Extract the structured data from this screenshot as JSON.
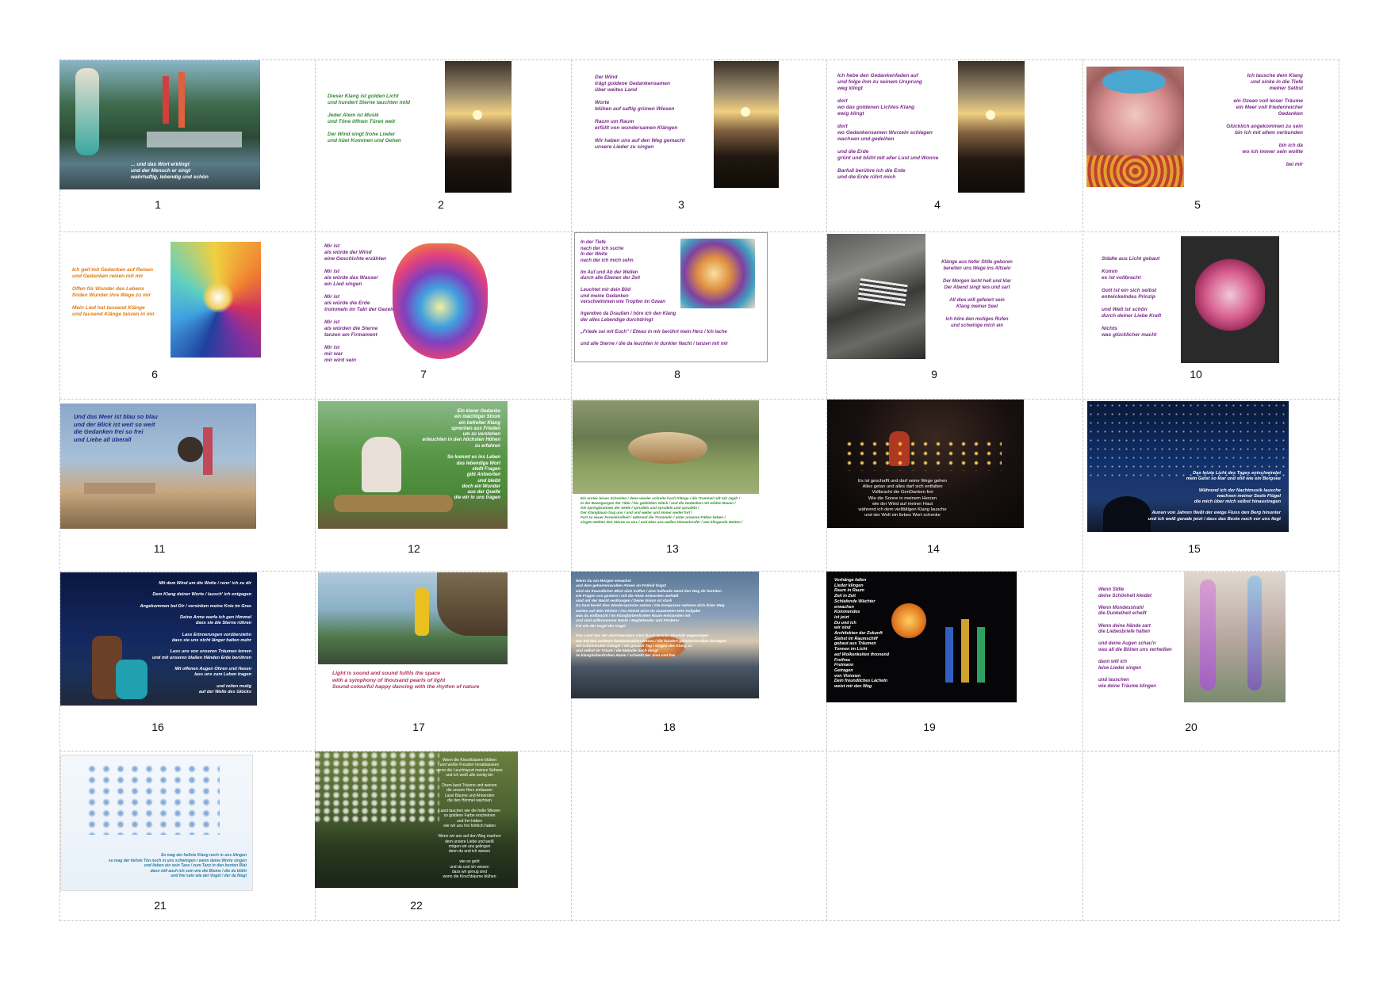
{
  "cards": [
    {
      "number": "1",
      "caption": "... und das Wort erklingt\nund der Mensch er singt\nwahrhaftig, lebendig und schön",
      "text_color": "#ffffff"
    },
    {
      "number": "2",
      "caption": "Dieser Klang ist golden Licht\nund hundert Sterne tauchten mild\n\nJeder Atem ist Musik\nund Töne öffnen Türen weit\n\nDer Wind singt frohe Lieder\nund hüet Kommen und Gehen",
      "text_color": "#2e8b2e"
    },
    {
      "number": "3",
      "caption": "Der Wind\nträgt goldene Gedankensamen\nüber weites Land\n\nWorte\nblühen auf saftig grünen Wiesen\n\nRaum um Raum\nerfüllt von wundersamen Klängen\n\nWir haben uns auf den Weg gemacht\nunsere Lieder zu singen",
      "text_color": "#7a2a8a"
    },
    {
      "number": "4",
      "caption": "Ich hebe den Gedankenfaden auf\nund folge ihm zu seinem Ursprung\nweg klingt\n\ndort\nwo das goldenen Lichtes Klang\newig klingt\n\ndort\nwo Gedankensamen Wurzeln schlagen\nwachsen und gedeihen\n\nund die Erde\ngrünt und blüht mit aller Lust und Wonne\n\nBarfuß berühre ich die Erde\nund die Erde rührt mich",
      "text_color": "#7a2a8a"
    },
    {
      "number": "5",
      "caption": "Ich lausche dem Klang\nund sinke in die Tiefe\nmeiner Selbst\n\nein Ozean voll leiser Träume\nein Meer voll friedenreicher\nGedanken\n\nGlücklich angekommen zu sein\nbin ich mit allem verbunden\n\nbin ich da\nwo ich immer sein wollte\n\nbei mir",
      "text_color": "#7a2a8a"
    },
    {
      "number": "6",
      "caption": "Ich geh'mit Gedanken auf Reisen\nund Gedanken reisen mit mir\n\nOffen für Wunder des Lebens\nfinden Wunder ihre Wege zu mir\n\nMein Lied hat tausend Klänge\nund tausend Klänge tanzen in mir",
      "text_color": "#e07a10"
    },
    {
      "number": "7",
      "caption": "Mir ist\nals würde der Wind\neine Geschichte erzählen\n\nMir ist\nals würde das Wasser\nein Lied singen\n\nMir ist\nals würde die Erde\ntrommeln im Takt der Gezeiten\n\nMir ist\nals würden die Sterne\ntanzen am Firmament\n\nMir ist\nmir war\nmir wird sein",
      "text_color": "#7a2a8a"
    },
    {
      "number": "8",
      "caption": "In der Tiefe\nnach der ich suche\nIn der Weite\nnach der ich mich sehn\n\nIm Auf und Ab der Wellen\ndurch alle Ebenen der Zeit\n\nLeuchtet mir dein Bild\nund meine Gedanken\nverschwimmen wie Tropfen im Ozean\n\nIrgendwo da Draußen / höre ich den Klang\nder alles Lebendige durchdringt\n\n„Friede sei mit Euch\" / Etwas in mir berührt mein Herz / Ich lache\n\nund alle Sterne / die da leuchten in dunkler Nacht / tanzen mit mir",
      "text_color": "#7a2a8a"
    },
    {
      "number": "9",
      "caption": "Klänge aus tiefer Stille geboren\nbereiten uns Wege ins Altsein\n\nDer Morgen lacht hell und klar\nDer Abend singt leis und sart\n\nAll dies will gefeiert sein\nKlang meiner Seel\n\nIch höre den mutiges Rufen\nund schwinge mich ein",
      "text_color": "#7a2a8a"
    },
    {
      "number": "10",
      "caption": "Städte aus Licht gebaut\n\nKomm\nes ist vollbracht\n\nGott ist ein sich selbst\nentwickelndes Prinzip\n\nund Welt ist schön\ndurch deiner Liebe Kraft\n\nNichts\nwas glücklicher macht",
      "text_color": "#7a2a8a"
    },
    {
      "number": "11",
      "caption": "Und das Meer ist blau so blau\nund der Blick ist weit so weit\ndie Gedanken frei so frei\nund Liebe all überall",
      "text_color": "#1a2a8a"
    },
    {
      "number": "12",
      "caption": "Ein klarer Gedanke\nein mächtiger Strom\nein befreiter Klang\nsprechen aus Frieden\num zu verstehen\nerleuchten in den höchsten Höhen\nzu erfahren\n\nSo kommt es ins Leben\ndas lebendige Wort\nstellt Fragen\ngibt Antworten\nund bleibt\ndoch ein Wunder\naus der Quelle\ndie wir in uns tragen",
      "text_color": "#ffffff"
    },
    {
      "number": "13",
      "caption": "Ein erstes leises Schreiten / denn wieder schreite hoch Klänge / die Trommel ruft mit Jagdr /\nIn der Bewegungen der Täler / bis geblieben Glück / und die Gedanken mit wilden Bauen /\nDie Springbrunnen der Seele / sprudeln und sprudeln und sprudeln /\nDer Klangbaum trug uns / und und weiter und immer weiter fort /\nFort zu neuer Ferienkindheit / während die Trommeln / unter unseren Füßen beben /\nsingen Welten den Sterne zu uns / und über uns wellen Himmelsrufer / wer klingende Weiten /",
      "text_color": "#2e8b2e"
    },
    {
      "number": "14",
      "caption": "Es ist geschafft und darf seine Wege gehen\nAlles getan und alles darf sich entfalten\nVollbracht die GenDanken frei\nWie die Sonne in meinem Herzen\nwie der Wind auf meiner Haut\nwährend ich dem vielfältigen Klang lausche\nund der Welt ein liebes Wort schenke",
      "text_color": "#ffffff"
    },
    {
      "number": "15",
      "caption": "Das letzte Licht des Tages entschwindet\nmein Geist so klar und still wie ein Bergsee\n\nWährend ich der Nachtmusik lausche\nwachsen meiner Seele Flügel\ndie mich über mich selbst hinaustragen\n\nAunen von Jahren fließt der ewige Fluss den Berg hinunter\nund ich weiß gerade jetzt / dass das Beste noch vor uns liegt",
      "text_color": "#ffffff"
    },
    {
      "number": "16",
      "caption": "Mit dem Wind um die Wette / renn' ich zu dir\n\nDem Klang deiner Worte / lausch' ich entgegen\n\nAngekommen bei Dir / versinken meine Knie im Gras\n\nDeine Arme warfa ich gen Himmel\ndass sie die Sterne rühren\n\nLass Erinnerungen vorüberziehn\ndass sie uns nicht länger halten mehr\n\nLass uns von unseren Träumen lernen\nund mit unseren blaßen Händen Erde berühren\n\nMit offenen Augen Ohren und Hasen\nlass uns zum Leben tragen\n\nund reiten mutig\nauf der Welle des Glücks",
      "text_color": "#ffffff"
    },
    {
      "number": "17",
      "caption": "Light is sound and sound fulfils the space\nwith a symphony of thousand pearls of light\nSound colourful happy dancing with the rhythm of nature",
      "text_color": "#b03060"
    },
    {
      "number": "18",
      "caption": "Wenn Du am Morgen erwachst\nund dem geheimnisvollen Atmen im Frühnil folgst\nwird ein freundlicher Blick dich treffen / eine helfende Hand den Weg dir bereiten\nDie Fragen von gestern / mit die Ahne Antworten umhüllt\nsind mit der Nacht verklungen / Deine Vision ist stark\nDu hast bereit dies Wiedersprüche setzen / Die Ereignisse nehmen dich ihren Weg\nwarten auf dein Wirken / Am Abend wirst du zusammen eine Aufgabe\nwas du vollbracht / Im Klangfarbenfrohen Raum entstanden mit\nund sind willkommene Gäste / Begleitender und Förderer\nfrei wie der Vogel der Vogel\n\nDas Land das Wir durchwandern wird durch Brücke überlebt wegerangen\nwer mit den anderen fundamentalen Wesen / die hundert geheimnisvollen Geistgen\nmit scheinenden Klänger / die gesund Tag / singen des Klang zu\nund selbst im Traum / die Melodie noch klingt\nim klangfarbenfrohen Raum / schenkt der Sinn und frei",
      "text_color": "#ffffff"
    },
    {
      "number": "19",
      "caption": "Vorhänge fallen\nLieder klingen\nRaum in Raum\nZeit in Zeit\nSchlafende Wächter\nerwachen\nKommendes\nist jetzt\nDu und ich\nwir sind\nArchitekten der Zukunft\nSiehst im Raumschiff\ngebaut aus Träumen\nTonnen im Licht\nauf Wolkenkeiten thronend\nFreifrau\nFreimann\nGetragen\nvon Visionen\nDein freundliches Lächeln\nweist mir den Weg",
      "text_color": "#ffffff"
    },
    {
      "number": "20",
      "caption": "Wenn Stille\ndeine Schönheit kleidet\n\nWenn Mondesstrahl\ndie Dunkelheit erhellt\n\nWenn deine Hände zart\ndie Liebesbriefe halten\n\nund deine Augen schau'n\nwas all die Blüten uns verheißen\n\ndann will ich\nleise Lieder singen\n\nund lauschen\nwie deine Träume klingen",
      "text_color": "#7a2a8a"
    },
    {
      "number": "21",
      "caption": "So mag der hellste Klang noch in uns klingen\nso mag der tiefste Ton noch in uns schwingen / wenn deine Worte singen\nund lieben ein sein Tanz / zum Tanz in den bunten Blat\ndann will auch ich sein wie die Blume / die da blüht\nund frei sein wie der Vogel / der da fliegt",
      "text_color": "#2a7aa0"
    },
    {
      "number": "22",
      "caption": "Wenn die Kirschbäume blühen\nund weiße Freuden herablasseen\nwenn die Leuchtspurt meines Sehens\nund ich weiß alle seelig bin\n\nDrum lasst Träume und weinen\ndie unsern Herz entlassen\nLasst Bäume und Ahnenden\ndie den Himmel wachsen\n\nLasst tauchen wie die helle Wiesen\nso goldene Farbe erscheinen\nund frei hätten\nwie wir uns frei fröhlich haben\n\nWenn wir uns auf den Weg machen\ndem unsere Liebe und weiß\nmögen wir uns gelingen\ndenn du und ich wissen\n\nwie es geht\nund du und ich wissen\ndass wir genug sind\nwenn die Kirschbäume blühen",
      "text_color": "#ffffff"
    }
  ]
}
